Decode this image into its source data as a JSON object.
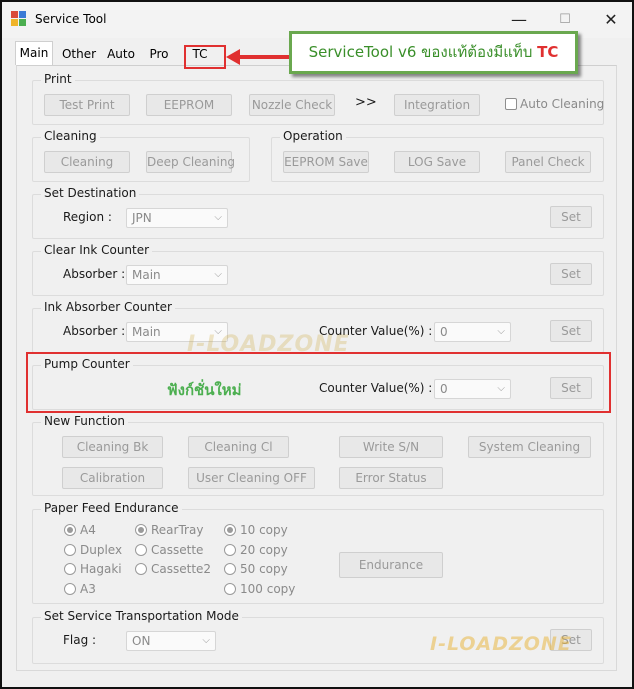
{
  "window": {
    "title": "Service Tool",
    "controls": {
      "minimize": "—",
      "maximize": "☐",
      "close": "✕"
    }
  },
  "tabs": [
    "Main",
    "Other",
    "Auto",
    "Pro",
    "TC"
  ],
  "callout": {
    "text_prefix": "ServiceTool v6 ของแท้ต้องมีแท็บ ",
    "text_highlight": "TC",
    "text_color": "#3a8f2a",
    "highlight_color": "#e03030",
    "border_color": "#6aa84f"
  },
  "print": {
    "label": "Print",
    "buttons": [
      "Test Print",
      "EEPROM",
      "Nozzle Check",
      "Integration"
    ],
    "arrow": ">>",
    "auto_cleaning": "Auto Cleaning"
  },
  "cleaning": {
    "label": "Cleaning",
    "buttons": [
      "Cleaning",
      "Deep Cleaning"
    ]
  },
  "operation": {
    "label": "Operation",
    "buttons": [
      "EEPROM Save",
      "LOG Save",
      "Panel Check"
    ]
  },
  "set_destination": {
    "label": "Set Destination",
    "field_label": "Region :",
    "value": "JPN",
    "set": "Set"
  },
  "clear_ink_counter": {
    "label": "Clear Ink Counter",
    "field_label": "Absorber :",
    "value": "Main",
    "set": "Set"
  },
  "ink_absorber_counter": {
    "label": "Ink Absorber Counter",
    "field_label": "Absorber :",
    "value": "Main",
    "counter_label": "Counter Value(%) :",
    "counter_value": "0",
    "set": "Set"
  },
  "pump_counter": {
    "label": "Pump Counter",
    "new_text": "ฟังก์ชั่นใหม่",
    "counter_label": "Counter Value(%) :",
    "counter_value": "0",
    "set": "Set"
  },
  "new_function": {
    "label": "New Function",
    "buttons": [
      "Cleaning Bk",
      "Cleaning Cl",
      "Write S/N",
      "System Cleaning",
      "Calibration",
      "User Cleaning OFF",
      "Error Status"
    ]
  },
  "paper_feed": {
    "label": "Paper Feed Endurance",
    "sizes": [
      "A4",
      "Duplex",
      "Hagaki",
      "A3"
    ],
    "trays": [
      "RearTray",
      "Cassette",
      "Cassette2"
    ],
    "copies": [
      "10 copy",
      "20 copy",
      "50 copy",
      "100 copy"
    ],
    "endurance": "Endurance"
  },
  "transport": {
    "label": "Set Service Transportation Mode",
    "field_label": "Flag :",
    "value": "ON",
    "set": "Set"
  },
  "watermark": "I-LOADZONE",
  "colors": {
    "highlight_red": "#e03030",
    "new_text_green": "#4caf50",
    "accent_green": "#6aa84f"
  }
}
